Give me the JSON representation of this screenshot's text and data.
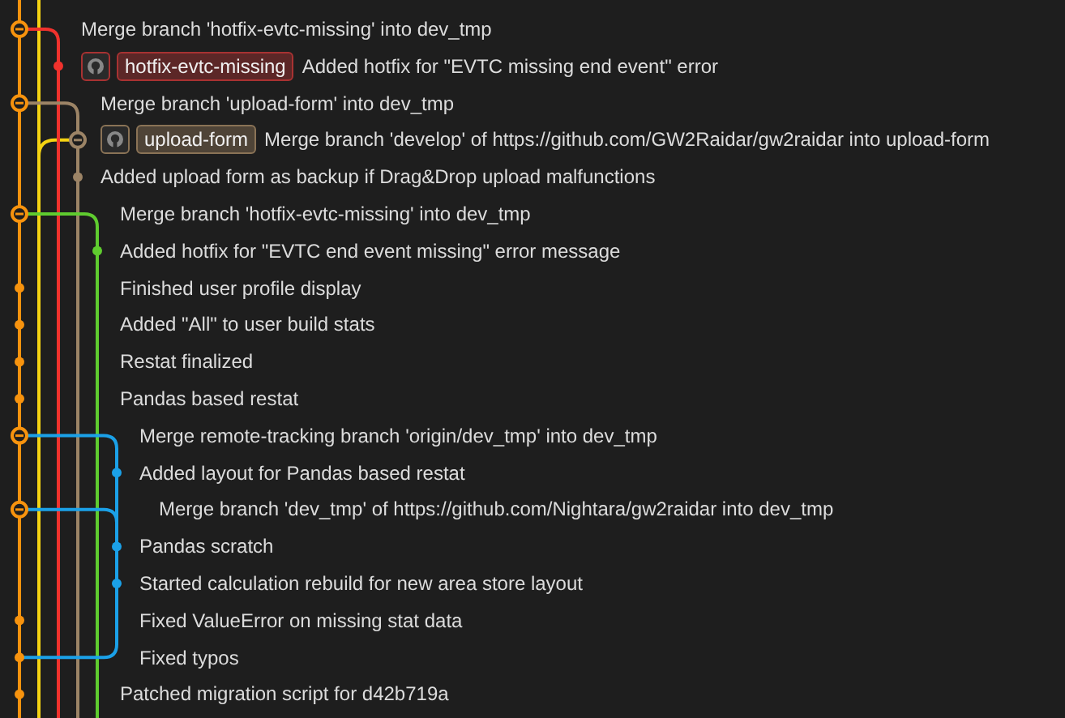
{
  "commits": [
    {
      "message": "Merge branch 'hotfix-evtc-missing' into dev_tmp"
    },
    {
      "message": "Added hotfix for \"EVTC missing end event\" error",
      "refs": [
        {
          "label": "hotfix-evtc-missing",
          "color": "#a83232"
        }
      ]
    },
    {
      "message": "Merge branch 'upload-form' into dev_tmp"
    },
    {
      "message": "Merge branch 'develop' of https://github.com/GW2Raidar/gw2raidar into upload-form",
      "refs": [
        {
          "label": "upload-form",
          "color": "#8a7356"
        }
      ]
    },
    {
      "message": "Added upload form as backup if Drag&Drop upload malfunctions"
    },
    {
      "message": "Merge branch 'hotfix-evtc-missing' into dev_tmp"
    },
    {
      "message": "Added hotfix for \"EVTC end event missing\" error message"
    },
    {
      "message": "Finished user profile display"
    },
    {
      "message": "Added \"All\" to user build stats"
    },
    {
      "message": "Restat finalized"
    },
    {
      "message": "Pandas based restat"
    },
    {
      "message": "Merge remote-tracking branch 'origin/dev_tmp' into dev_tmp"
    },
    {
      "message": "Added layout for Pandas based restat"
    },
    {
      "message": "Merge branch 'dev_tmp' of https://github.com/Nightara/gw2raidar into dev_tmp"
    },
    {
      "message": "Pandas scratch"
    },
    {
      "message": "Started calculation rebuild for new area store layout"
    },
    {
      "message": "Fixed ValueError on missing stat data"
    },
    {
      "message": "Fixed typos"
    },
    {
      "message": "Patched migration script for d42b719a"
    }
  ]
}
